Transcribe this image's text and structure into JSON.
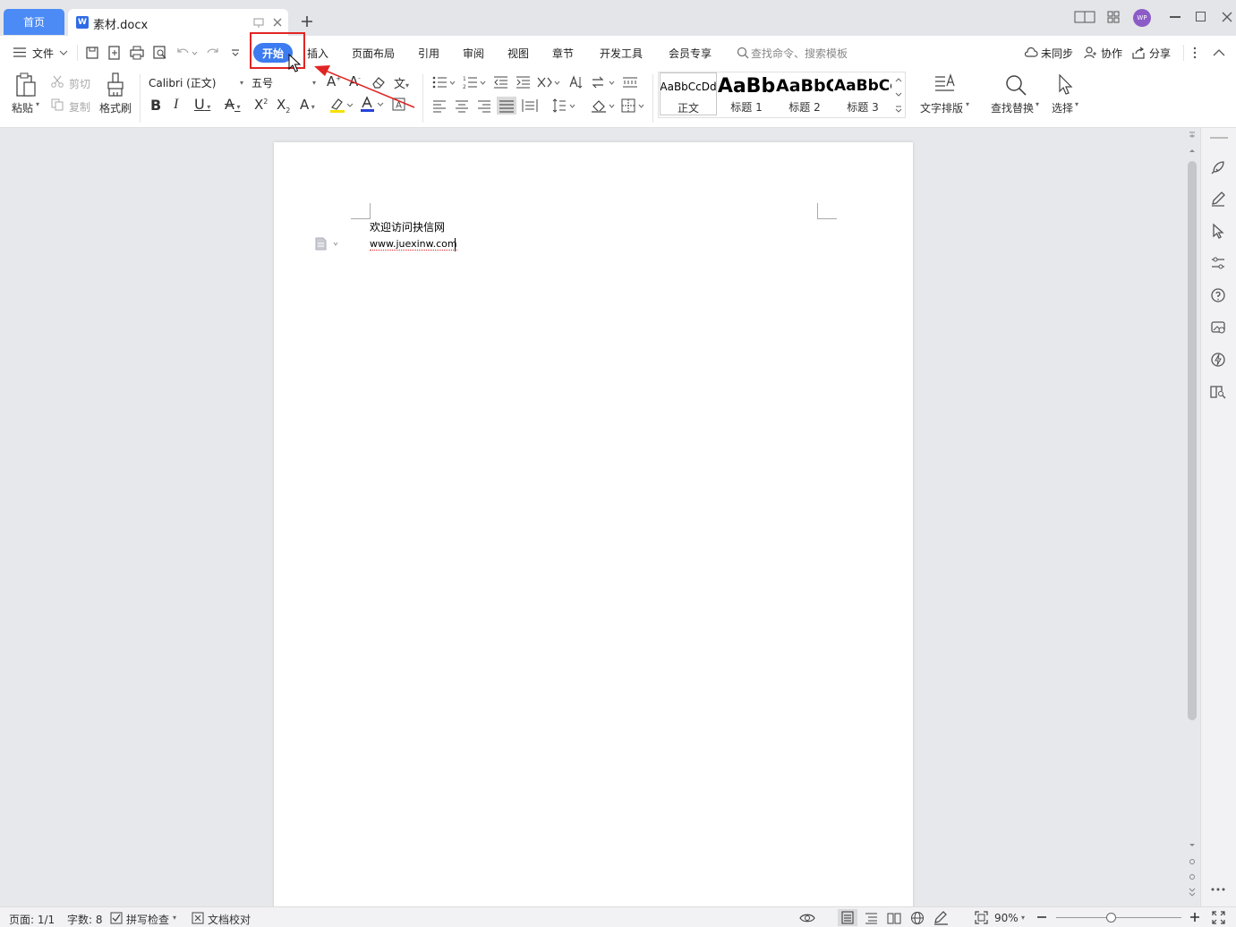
{
  "tabs": {
    "home": "首页",
    "document": "素材.docx"
  },
  "menu": {
    "file": "文件",
    "items": [
      "开始",
      "插入",
      "页面布局",
      "引用",
      "审阅",
      "视图",
      "章节",
      "开发工具",
      "会员专享"
    ],
    "search_placeholder": "查找命令、搜索模板",
    "sync": "未同步",
    "collab": "协作",
    "share": "分享"
  },
  "ribbon": {
    "paste": "粘贴",
    "cut": "剪切",
    "copy": "复制",
    "format_painter": "格式刷",
    "font_name": "Calibri (正文)",
    "font_size": "五号",
    "styles": [
      {
        "sample": "AaBbCcDd",
        "caption": "正文"
      },
      {
        "sample": "AaBb",
        "caption": "标题 1"
      },
      {
        "sample": "AaBbC",
        "caption": "标题 2"
      },
      {
        "sample": "AaBbCc",
        "caption": "标题 3"
      }
    ],
    "text_layout": "文字排版",
    "find_replace": "查找替换",
    "select": "选择"
  },
  "document": {
    "line1": "欢迎访问抉信网",
    "line2": "www.juexinw.com"
  },
  "status": {
    "page": "页面: 1/1",
    "words": "字数: 8",
    "spellcheck": "拼写检查",
    "proofread": "文档校对",
    "zoom": "90%"
  },
  "colors": {
    "accent": "#3c7bf0",
    "annotation": "#e02424",
    "avatar": "#8b5cc7"
  },
  "avatar_text": "WP"
}
